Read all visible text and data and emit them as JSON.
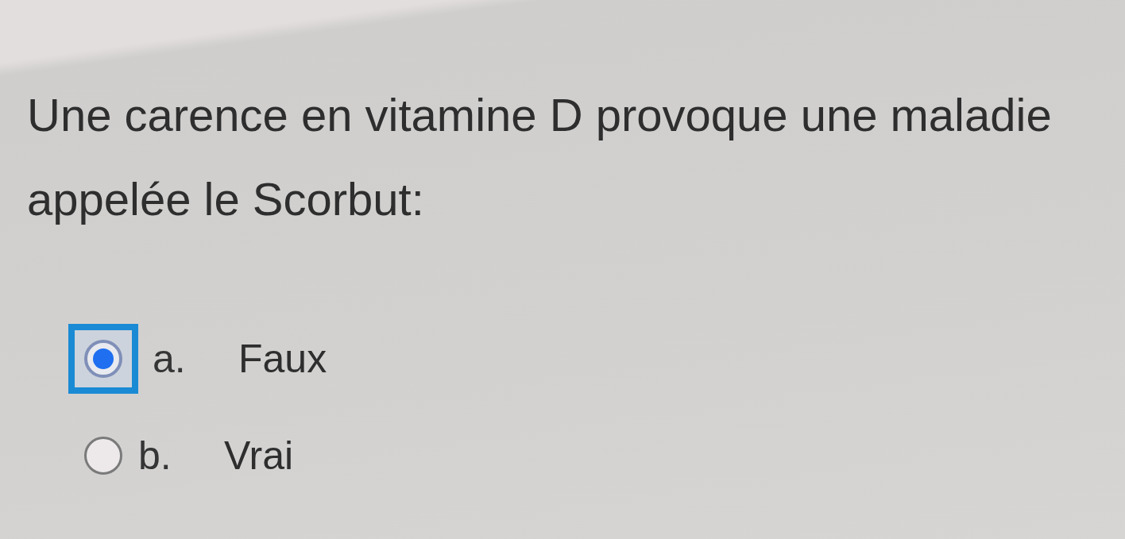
{
  "question": {
    "text": "Une carence en vitamine D provoque une maladie appelée le Scorbut:"
  },
  "options": [
    {
      "letter": "a.",
      "label": "Faux",
      "selected": true,
      "focused": true
    },
    {
      "letter": "b.",
      "label": "Vrai",
      "selected": false,
      "focused": false
    }
  ]
}
